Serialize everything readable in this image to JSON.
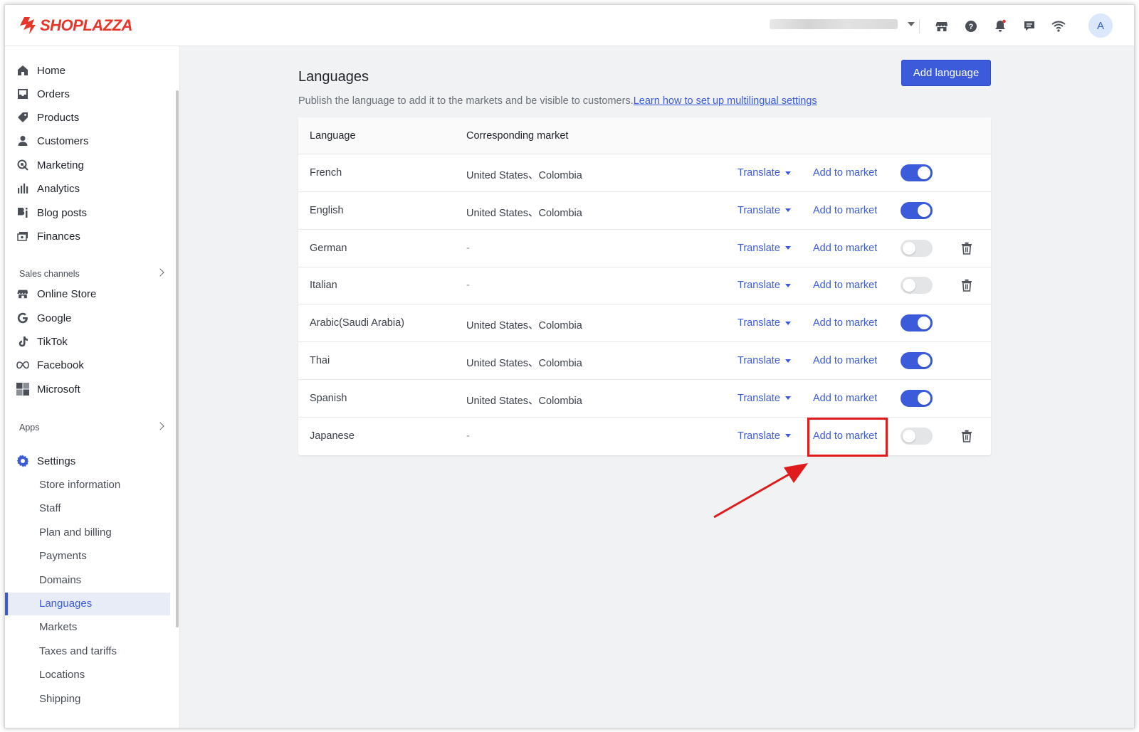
{
  "header": {
    "brand": "SHOPLAZZA",
    "avatar_initial": "A",
    "icons": [
      "store-icon",
      "help-icon",
      "notification-bell-icon",
      "chat-icon",
      "wifi-icon"
    ]
  },
  "sidebar": {
    "main_items": [
      {
        "label": "Home",
        "icon": "home-icon"
      },
      {
        "label": "Orders",
        "icon": "orders-icon"
      },
      {
        "label": "Products",
        "icon": "tag-icon"
      },
      {
        "label": "Customers",
        "icon": "person-icon"
      },
      {
        "label": "Marketing",
        "icon": "marketing-icon"
      },
      {
        "label": "Analytics",
        "icon": "bar-chart-icon"
      },
      {
        "label": "Blog posts",
        "icon": "blog-icon"
      },
      {
        "label": "Finances",
        "icon": "finances-icon"
      }
    ],
    "sales_channels_label": "Sales channels",
    "channels": [
      {
        "label": "Online Store",
        "icon": "store-icon"
      },
      {
        "label": "Google",
        "icon": "google-icon"
      },
      {
        "label": "TikTok",
        "icon": "tiktok-icon"
      },
      {
        "label": "Facebook",
        "icon": "meta-icon"
      },
      {
        "label": "Microsoft",
        "icon": "microsoft-icon"
      }
    ],
    "apps_label": "Apps",
    "settings_label": "Settings",
    "settings_items": [
      "Store information",
      "Staff",
      "Plan and billing",
      "Payments",
      "Domains",
      "Languages",
      "Markets",
      "Taxes and tariffs",
      "Locations",
      "Shipping"
    ],
    "active_item": "Languages",
    "active_color": "#3b5bdb"
  },
  "main": {
    "title": "Languages",
    "description": "Publish the language to add it to the markets and be visible to customers.",
    "help_link": "Learn how to set up multilingual settings",
    "add_button": "Add language",
    "table": {
      "headers": [
        "Language",
        "Corresponding market"
      ],
      "translate_label": "Translate",
      "add_market_label": "Add to market",
      "rows": [
        {
          "language": "French",
          "market": "United States、Colombia",
          "published": true,
          "deletable": false
        },
        {
          "language": "English",
          "market": "United States、Colombia",
          "published": true,
          "deletable": false
        },
        {
          "language": "German",
          "market": "-",
          "published": false,
          "deletable": true
        },
        {
          "language": "Italian",
          "market": "-",
          "published": false,
          "deletable": true
        },
        {
          "language": "Arabic(Saudi Arabia)",
          "market": "United States、Colombia",
          "published": true,
          "deletable": false
        },
        {
          "language": "Thai",
          "market": "United States、Colombia",
          "published": true,
          "deletable": false
        },
        {
          "language": "Spanish",
          "market": "United States、Colombia",
          "published": true,
          "deletable": false
        },
        {
          "language": "Japanese",
          "market": "-",
          "published": false,
          "deletable": true
        }
      ]
    }
  },
  "annotation": {
    "highlight_color": "#e01b1b"
  }
}
